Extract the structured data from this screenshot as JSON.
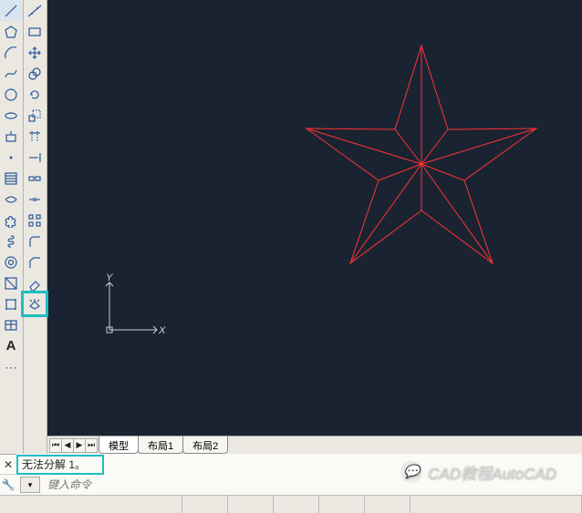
{
  "tabs": {
    "model": "模型",
    "layout1": "布局1",
    "layout2": "布局2"
  },
  "cmd": {
    "history": "无法分解 1。",
    "placeholder": "键入命令"
  },
  "ucs": {
    "x_label": "X",
    "y_label": "Y"
  },
  "watermark": "CAD教程AutoCAD",
  "chart_data": {
    "type": "diagram",
    "description": "Five-pointed red star (wireframe) drawn with connecting lines to center, in AutoCAD model space",
    "center": [
      410,
      180
    ],
    "outer_radius": 130,
    "inner_radius": 48,
    "rotation_deg": -90,
    "color": "#f33"
  }
}
